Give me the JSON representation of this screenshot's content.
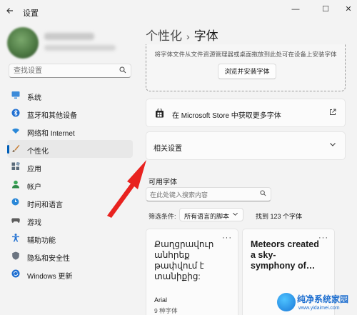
{
  "window": {
    "title": "设置",
    "back_icon": "arrow-left-icon",
    "minimize_glyph": "—",
    "maximize_glyph": "☐",
    "close_glyph": "✕"
  },
  "sidebar": {
    "search_placeholder": "查找设置",
    "items": [
      {
        "label": "系统",
        "icon": "monitor-icon",
        "color": "#3c8bd9"
      },
      {
        "label": "蓝牙和其他设备",
        "icon": "bluetooth-icon",
        "color": "#1f6fd1"
      },
      {
        "label": "网络和 Internet",
        "icon": "wifi-icon",
        "color": "#2b88d8"
      },
      {
        "label": "个性化",
        "icon": "paintbrush-icon",
        "color": "#c8813a",
        "active": true
      },
      {
        "label": "应用",
        "icon": "apps-icon",
        "color": "#5b6b7a"
      },
      {
        "label": "帐户",
        "icon": "person-icon",
        "color": "#3aa757"
      },
      {
        "label": "时间和语言",
        "icon": "globe-clock-icon",
        "color": "#2b88d8"
      },
      {
        "label": "游戏",
        "icon": "gamepad-icon",
        "color": "#5d5d5d"
      },
      {
        "label": "辅助功能",
        "icon": "accessibility-icon",
        "color": "#1f6fd1"
      },
      {
        "label": "隐私和安全性",
        "icon": "shield-icon",
        "color": "#6b7480"
      },
      {
        "label": "Windows 更新",
        "icon": "update-icon",
        "color": "#1f6fd1"
      }
    ]
  },
  "main": {
    "breadcrumb_parent": "个性化",
    "breadcrumb_sep": "›",
    "breadcrumb_current": "字体",
    "drop_text": "将字体文件从文件资源管理器或桌面拖放到此处可在设备上安装字体",
    "browse_button": "浏览并安装字体",
    "store_text": "在 Microsoft Store 中获取更多字体",
    "related_settings": "相关设置",
    "available_fonts_label": "可用字体",
    "font_search_placeholder": "在此处键入搜索内容",
    "filter_label": "筛选条件:",
    "filter_value": "所有语言的脚本",
    "found_text": "找到 123 个字体",
    "fonts": [
      {
        "preview": "Քաղցրավուր անհրեք թափվում է տանիքից:",
        "name": "Arial",
        "count": "9 种字体"
      },
      {
        "preview": "Meteors created a sky-symphony of…",
        "name": "",
        "count": ""
      }
    ]
  },
  "watermark": {
    "title": "纯净系统家园",
    "url": "www.yidaimei.com"
  }
}
